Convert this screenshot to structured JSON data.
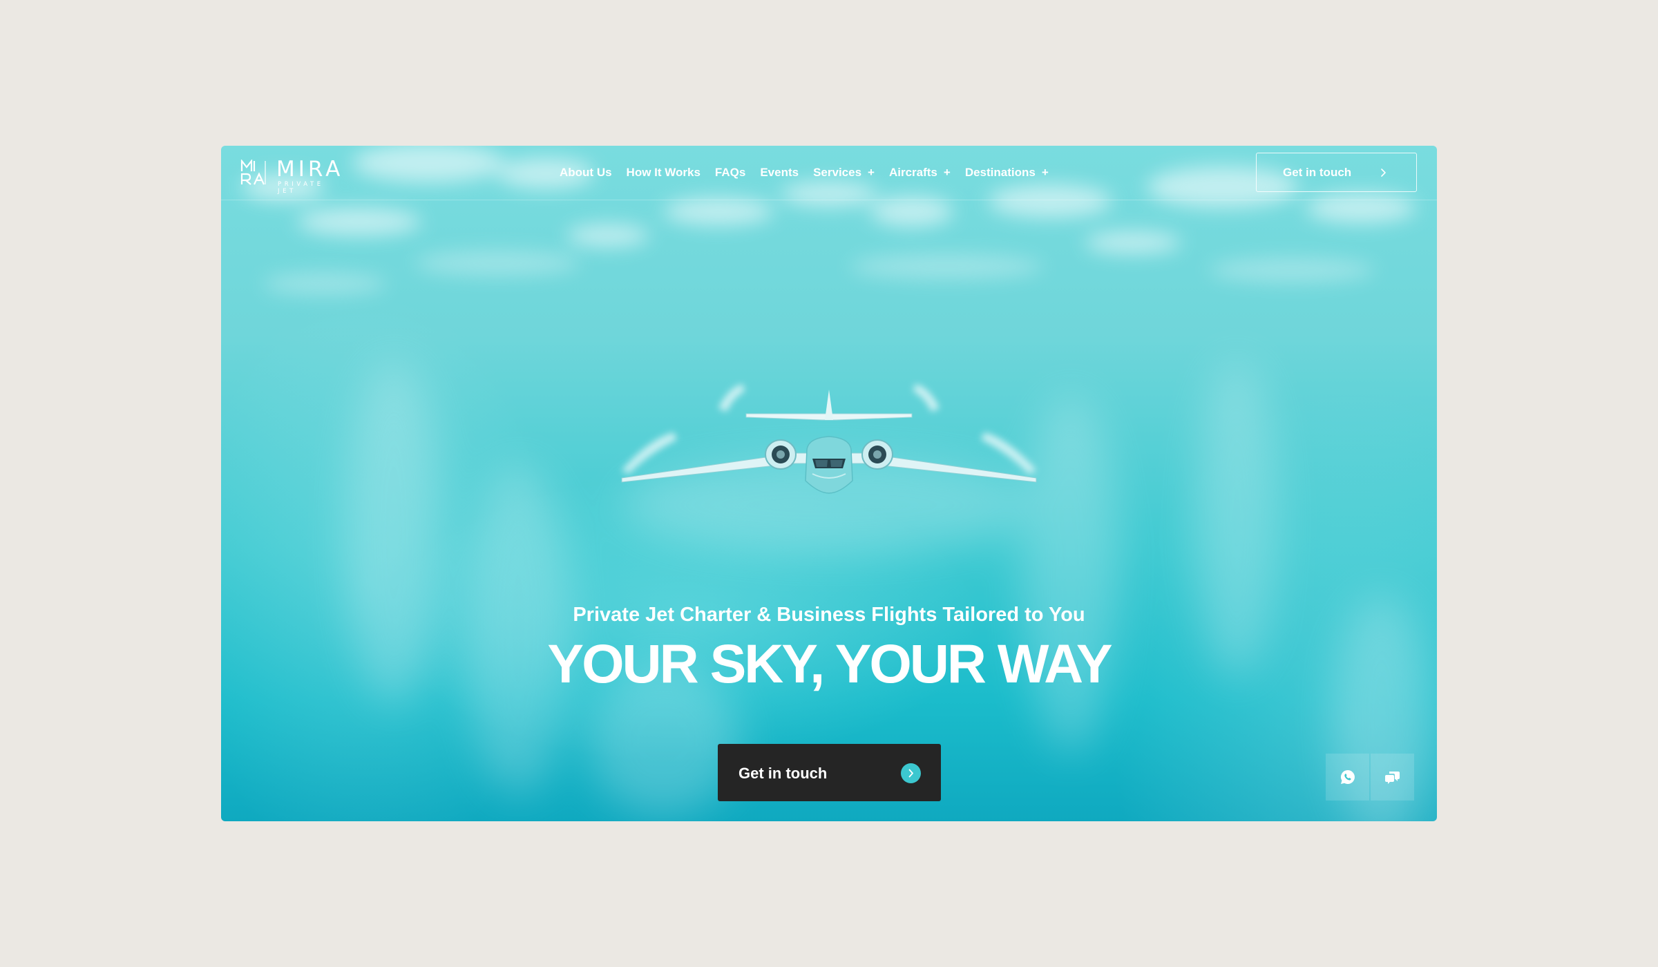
{
  "brand": {
    "name": "MIRA",
    "tagline": "PRIVATE JET",
    "mark_letters": "MIRA"
  },
  "nav": {
    "items": [
      {
        "label": "About Us",
        "has_submenu": false
      },
      {
        "label": "How It Works",
        "has_submenu": false
      },
      {
        "label": "FAQs",
        "has_submenu": false
      },
      {
        "label": "Events",
        "has_submenu": false
      },
      {
        "label": "Services",
        "has_submenu": true
      },
      {
        "label": "Aircrafts",
        "has_submenu": true
      },
      {
        "label": "Destinations",
        "has_submenu": true
      }
    ],
    "submenu_marker": "+",
    "cta_label": "Get in touch",
    "cta_icon": "chevron-right-icon"
  },
  "hero": {
    "subtitle": "Private Jet Charter & Business Flights Tailored to You",
    "title": "YOUR SKY, YOUR WAY",
    "cta_label": "Get in touch",
    "cta_icon": "chevron-right-circle-icon",
    "background": "private-jet-above-clouds-photo"
  },
  "floating_actions": [
    {
      "name": "whatsapp-icon"
    },
    {
      "name": "chat-bubbles-icon"
    }
  ],
  "colors": {
    "page_background": "#ebe8e3",
    "hero_top": "#79dcdf",
    "hero_bottom": "#0fa9c0",
    "accent": "#3cc7cf",
    "cta_background": "#252525",
    "text": "#ffffff"
  }
}
